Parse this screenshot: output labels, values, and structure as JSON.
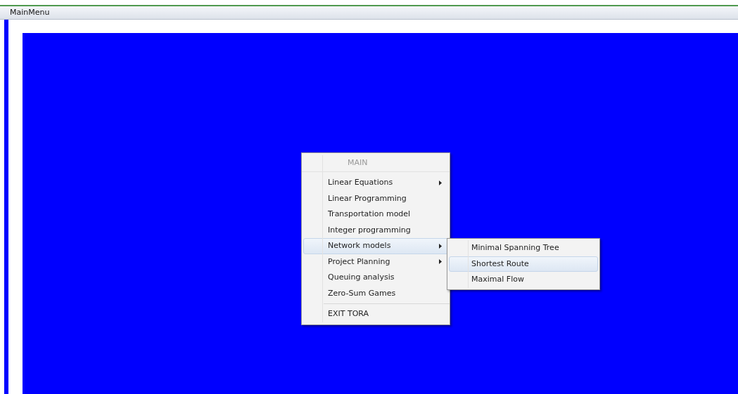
{
  "window": {
    "title": "MainMenu"
  },
  "menu": {
    "items": [
      {
        "kind": "header",
        "label": "MAIN"
      },
      {
        "kind": "item",
        "label": "Linear Equations",
        "submenu": true,
        "selected": false
      },
      {
        "kind": "item",
        "label": "Linear Programming",
        "submenu": false,
        "selected": false
      },
      {
        "kind": "item",
        "label": "Transportation model",
        "submenu": false,
        "selected": false
      },
      {
        "kind": "item",
        "label": "Integer programming",
        "submenu": false,
        "selected": false
      },
      {
        "kind": "item",
        "label": "Network models",
        "submenu": true,
        "selected": true
      },
      {
        "kind": "item",
        "label": "Project Planning",
        "submenu": true,
        "selected": false
      },
      {
        "kind": "item",
        "label": "Queuing analysis",
        "submenu": false,
        "selected": false
      },
      {
        "kind": "item",
        "label": "Zero-Sum Games",
        "submenu": false,
        "selected": false
      },
      {
        "kind": "separator"
      },
      {
        "kind": "item",
        "label": "EXIT TORA",
        "submenu": false,
        "selected": false
      }
    ]
  },
  "submenu": {
    "items": [
      {
        "label": "Minimal Spanning Tree",
        "selected": false
      },
      {
        "label": "Shortest Route",
        "selected": true
      },
      {
        "label": "Maximal Flow",
        "selected": false
      }
    ]
  }
}
